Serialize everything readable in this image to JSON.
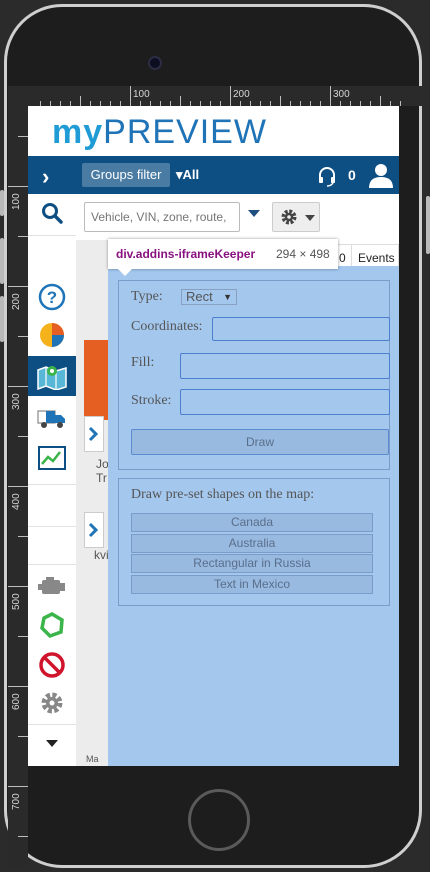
{
  "ruler": {
    "marks": [
      "100",
      "200",
      "300",
      "100",
      "200",
      "300",
      "400",
      "500",
      "600",
      "700"
    ]
  },
  "logo": {
    "prefix": "my",
    "name": "PREVIEW"
  },
  "header": {
    "groups_filter": "Groups filter",
    "all": "All",
    "count": "0"
  },
  "toolbar": {
    "search_placeholder": "Vehicle, VIN, zone, route,"
  },
  "tooltip": {
    "name": "div.addins-iframeKeeper",
    "size": "294 × 498"
  },
  "tabs": {
    "partial": "0",
    "events": "Events"
  },
  "map": {
    "t1": "Jo",
    "t2": "Tr",
    "t3": "kvil",
    "t4": "Ma"
  },
  "form": {
    "type_label": "Type:",
    "type_value": "Rect",
    "coordinates_label": "Coordinates:",
    "fill_label": "Fill:",
    "stroke_label": "Stroke:",
    "draw_button": "Draw"
  },
  "preset": {
    "title": "Draw pre-set shapes on the map:",
    "buttons": [
      "Canada",
      "Australia",
      "Rectangular in Russia",
      "Text in Mexico"
    ]
  },
  "colors": {
    "header": "#0e4f83",
    "logo_my": "#1f9bd6",
    "frame": "#a4c7ee",
    "map_orange": "#e65f22"
  }
}
